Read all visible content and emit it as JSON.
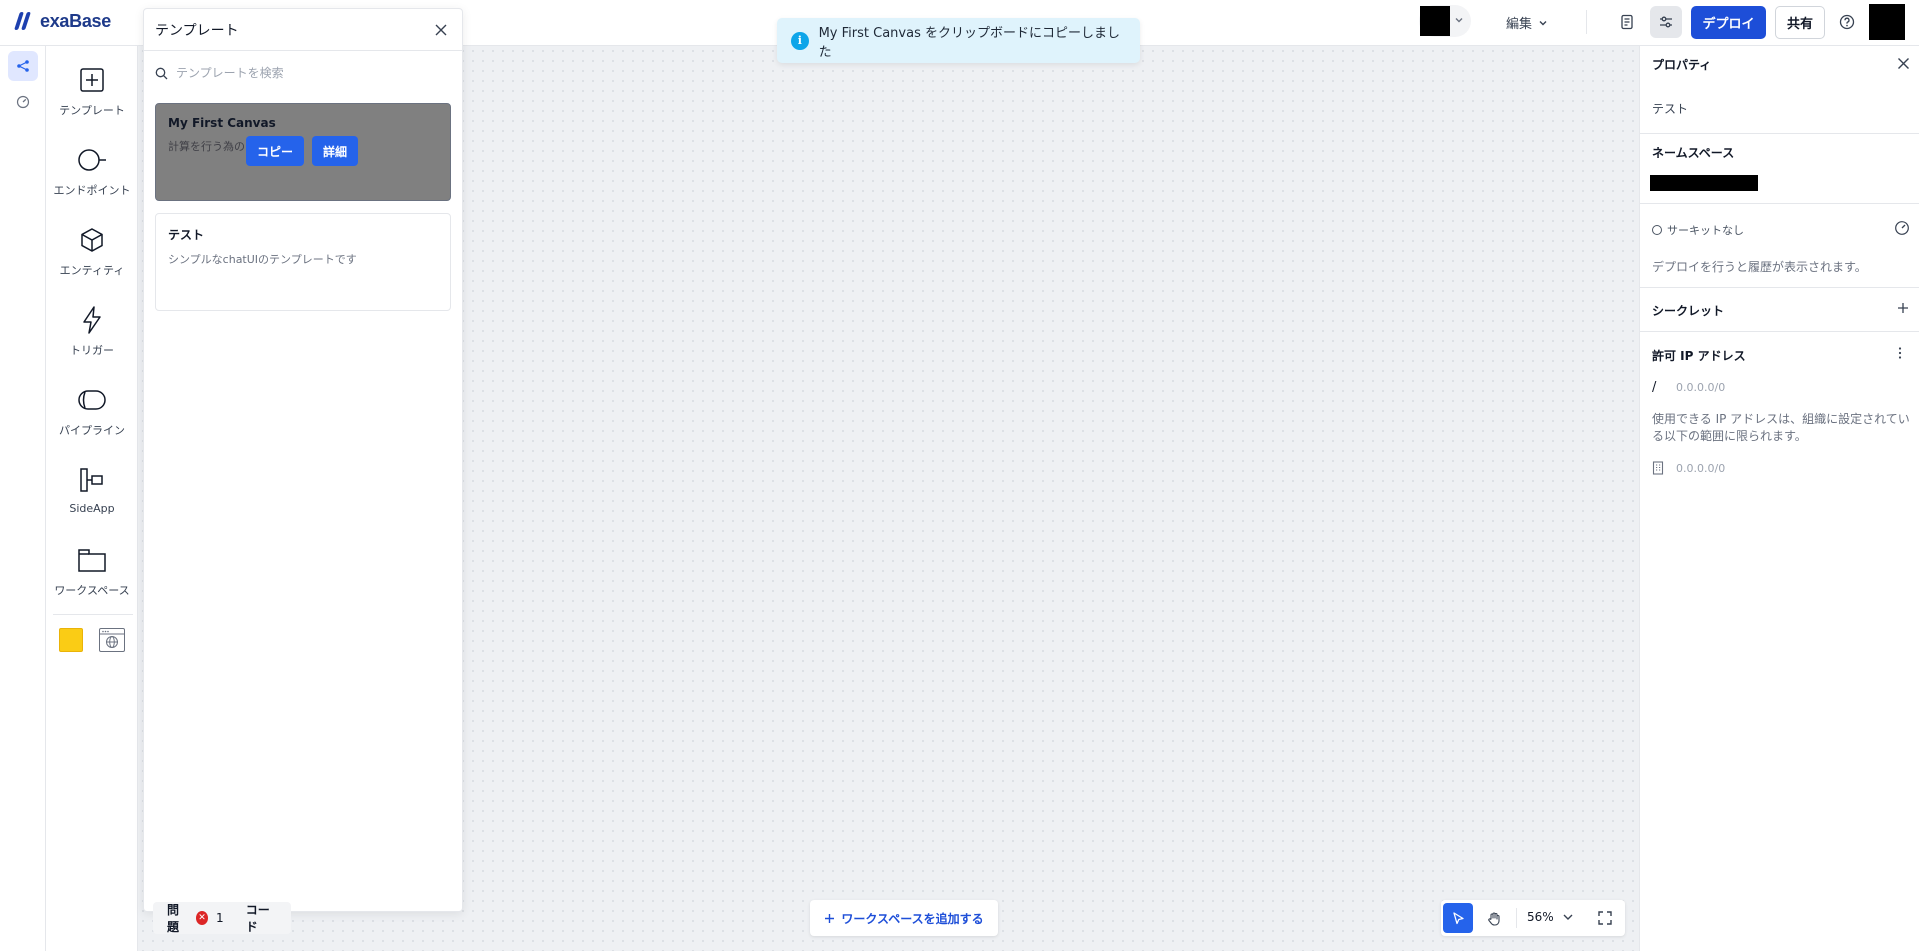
{
  "app": {
    "brand": "exaBase"
  },
  "topbar": {
    "edit_label": "編集",
    "deploy_label": "デプロイ",
    "share_label": "共有"
  },
  "toolbox": {
    "items": [
      {
        "label": "テンプレート",
        "icon": "plus-square-icon"
      },
      {
        "label": "エンドポイント",
        "icon": "endpoint-icon"
      },
      {
        "label": "エンティティ",
        "icon": "cube-icon"
      },
      {
        "label": "トリガー",
        "icon": "lightning-icon"
      },
      {
        "label": "パイプライン",
        "icon": "pipeline-icon"
      },
      {
        "label": "SideApp",
        "icon": "sideapp-icon"
      },
      {
        "label": "ワークスペース",
        "icon": "folder-icon"
      }
    ]
  },
  "templates": {
    "title": "テンプレート",
    "search_placeholder": "テンプレートを検索",
    "cards": [
      {
        "name": "My First Canvas",
        "desc": "計算を行う為の"
      },
      {
        "name": "テスト",
        "desc": "シンプルなchatUIのテンプレートです"
      }
    ],
    "copy_label": "コピー",
    "detail_label": "詳細"
  },
  "toast": {
    "message": "My First Canvas をクリップボードにコピーしました"
  },
  "bottom": {
    "issues_label": "問題",
    "issues_count": "1",
    "code_label": "コード",
    "add_workspace_label": "ワークスペースを追加する",
    "zoom": "56%"
  },
  "properties": {
    "title": "プロパティ",
    "name": "テスト",
    "namespace_title": "ネームスペース",
    "circuit_label": "サーキットなし",
    "history_note": "デプロイを行うと履歴が表示されます。",
    "secret_title": "シークレット",
    "ip_title": "許可 IP アドレス",
    "ip_prefix": "/",
    "ip_value": "0.0.0.0/0",
    "ip_note": "使用できる IP アドレスは、組織に設定されている以下の範囲に限られます。",
    "org_ip_value": "0.0.0.0/0"
  },
  "colors": {
    "accent": "#2563eb",
    "toast_bg": "#dff3fc",
    "error": "#dc2626"
  }
}
